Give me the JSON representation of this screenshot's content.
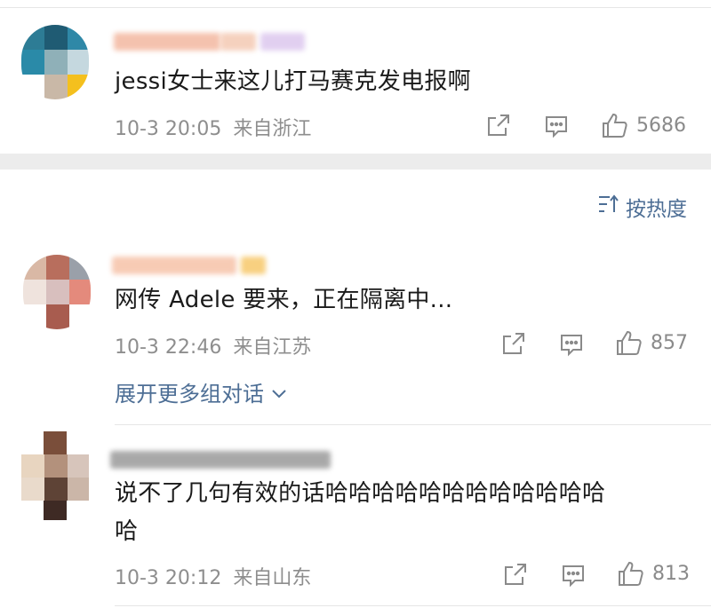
{
  "comments": [
    {
      "text": "jessi女士来这儿打马赛克发电报啊",
      "time": "10-3 20:05",
      "location": "来自浙江",
      "likes": "5686"
    },
    {
      "text": "网传 Adele 要来，正在隔离中...",
      "time": "10-3 22:46",
      "location": "来自江苏",
      "likes": "857"
    },
    {
      "text_line1": "说不了几句有效的话哈哈哈哈哈哈哈哈哈哈哈哈",
      "text_line2": "哈",
      "time": "10-3 20:12",
      "location": "来自山东",
      "likes": "813"
    }
  ],
  "sort": {
    "label": "按热度"
  },
  "expand": {
    "label": "展开更多组对话"
  },
  "colors": {
    "link": "#4d6e95",
    "meta": "#8e8e8e",
    "icon": "#8a8a8a"
  },
  "icons": [
    "share-icon",
    "comment-icon",
    "like-icon",
    "sort-icon",
    "chevron-down-icon"
  ]
}
